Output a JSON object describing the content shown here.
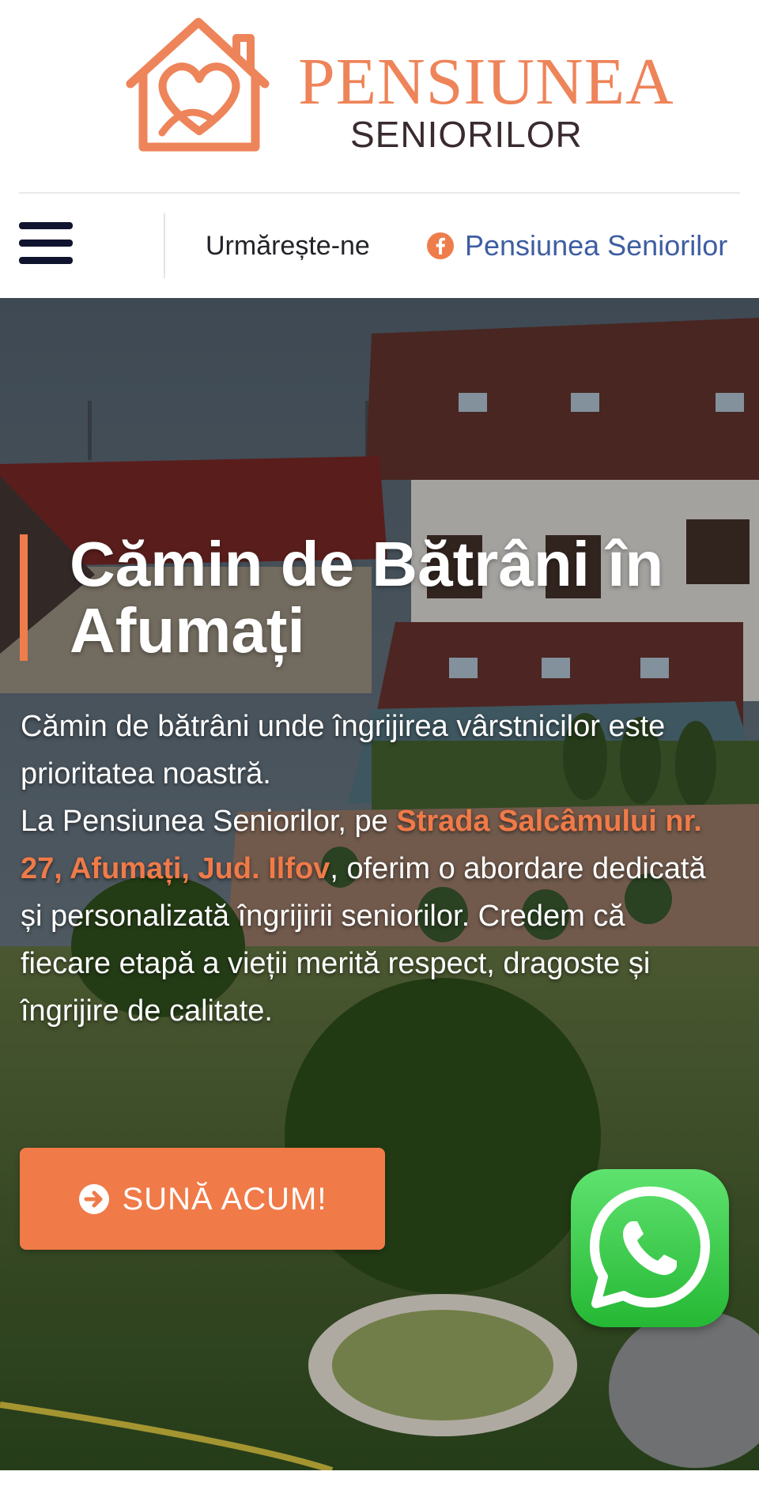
{
  "brand": {
    "title": "PENSIUNEA",
    "subtitle": "SENIORILOR",
    "logo_icon": "house-heart-icon",
    "color_primary": "#ee8459",
    "color_dark": "#3a2b2e"
  },
  "navbar": {
    "menu_icon": "hamburger-menu-icon",
    "follow_label": "Urmărește-ne",
    "facebook_icon": "facebook-icon",
    "facebook_label": "Pensiunea Seniorilor",
    "facebook_color": "#3e5da2"
  },
  "hero": {
    "title": "Cămin de Bătrâni în Afumați",
    "paragraph_1": "Cămin de bătrâni unde îngrijirea vârstnicilor este prioritatea noastră.",
    "paragraph_2_before": "La Pensiunea Seniorilor, pe ",
    "address": "Strada Salcâmului nr. 27, Afumați, Jud. Ilfov",
    "paragraph_2_after": ", oferim o abordare dedicată și personalizată îngrijirii seniorilor. Credem că fiecare etapă a vieții merită respect, dragoste și îngrijire de calitate.",
    "accent_color": "#ee7d4b",
    "background": "nursing-home-building-photo"
  },
  "cta": {
    "label": "SUNĂ ACUM!",
    "icon": "arrow-right-circle-icon",
    "color": "#f07a48"
  },
  "whatsapp": {
    "icon": "whatsapp-icon",
    "color": "#25b834"
  }
}
